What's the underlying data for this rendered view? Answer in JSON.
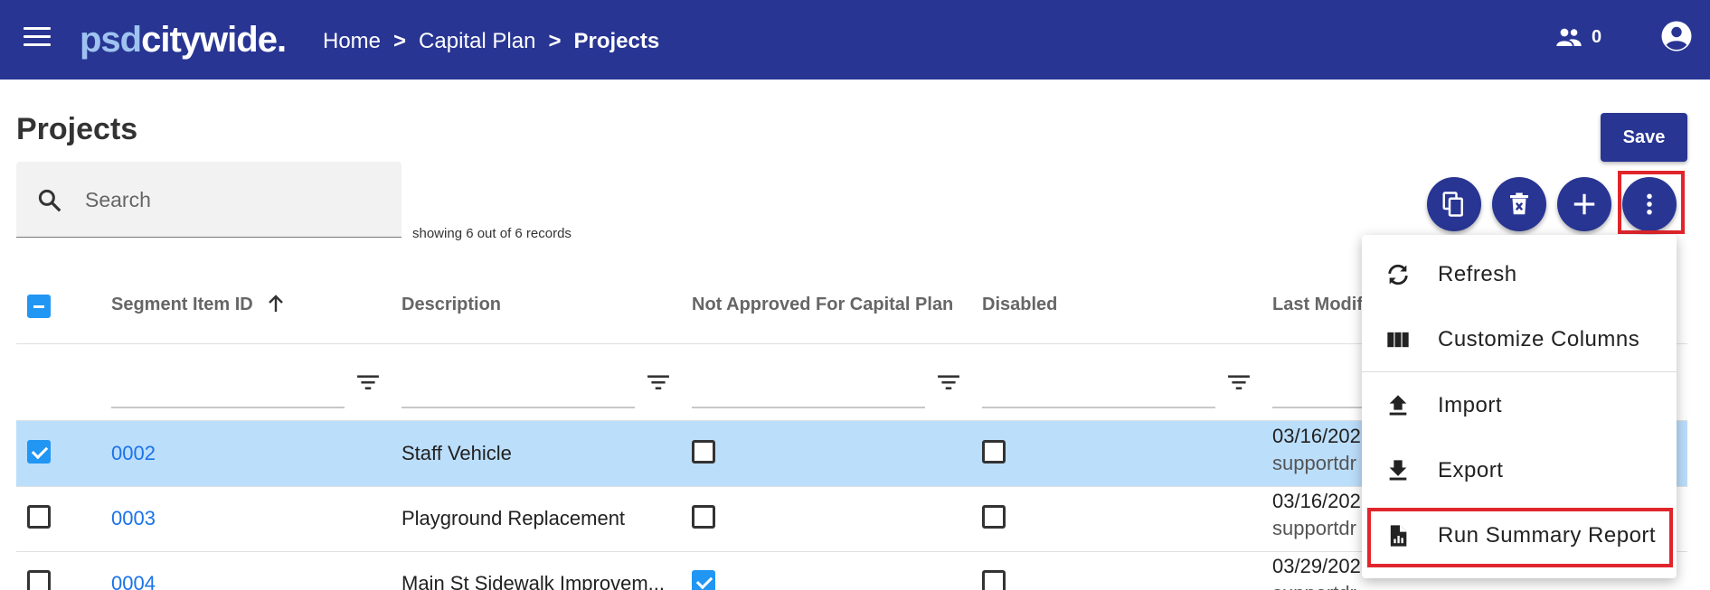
{
  "app": {
    "logo_part1": "psd",
    "logo_part2": "citywide."
  },
  "breadcrumb": {
    "items": [
      "Home",
      "Capital Plan",
      "Projects"
    ],
    "separator": ">"
  },
  "header": {
    "users_count": "0"
  },
  "page": {
    "title": "Projects",
    "save_label": "Save"
  },
  "search": {
    "placeholder": "Search",
    "records_text": "showing 6 out of 6 records"
  },
  "toolbar": {
    "icons": [
      "copy-icon",
      "delete-icon",
      "add-icon",
      "more-vert-icon"
    ]
  },
  "table": {
    "columns": [
      "Segment Item ID",
      "Description",
      "Not Approved For Capital Plan",
      "Disabled",
      "Last Modif"
    ],
    "rows": [
      {
        "id": "0002",
        "description": "Staff Vehicle",
        "not_approved": false,
        "disabled": false,
        "modified_date": "03/16/202",
        "modified_by": "supportdr",
        "selected": true
      },
      {
        "id": "0003",
        "description": "Playground Replacement",
        "not_approved": false,
        "disabled": false,
        "modified_date": "03/16/202",
        "modified_by": "supportdr",
        "selected": false
      },
      {
        "id": "0004",
        "description": "Main St Sidewalk Improvem...",
        "not_approved": true,
        "disabled": false,
        "modified_date": "03/29/202",
        "modified_by": "supportdr",
        "selected": false
      }
    ]
  },
  "menu": {
    "items": [
      {
        "label": "Refresh",
        "icon": "refresh-icon"
      },
      {
        "label": "Customize Columns",
        "icon": "columns-icon"
      },
      {
        "label": "Import",
        "icon": "upload-icon"
      },
      {
        "label": "Export",
        "icon": "download-icon"
      },
      {
        "label": "Run Summary Report",
        "icon": "report-icon"
      }
    ]
  },
  "colors": {
    "primary": "#283593",
    "selected_row": "#bbdefb",
    "checkbox": "#2196f3",
    "link": "#1a73e8",
    "highlight": "#e0252b"
  }
}
